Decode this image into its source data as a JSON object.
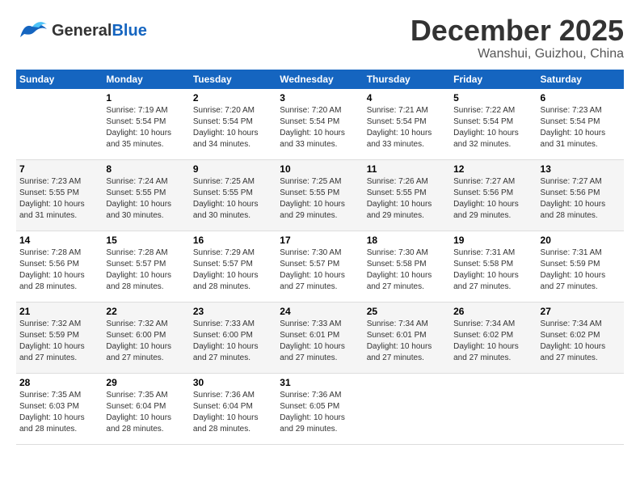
{
  "header": {
    "logo_line1": "General",
    "logo_line2": "Blue",
    "month": "December 2025",
    "location": "Wanshui, Guizhou, China"
  },
  "weekdays": [
    "Sunday",
    "Monday",
    "Tuesday",
    "Wednesday",
    "Thursday",
    "Friday",
    "Saturday"
  ],
  "rows": [
    [
      {
        "day": "",
        "info": ""
      },
      {
        "day": "1",
        "info": "Sunrise: 7:19 AM\nSunset: 5:54 PM\nDaylight: 10 hours\nand 35 minutes."
      },
      {
        "day": "2",
        "info": "Sunrise: 7:20 AM\nSunset: 5:54 PM\nDaylight: 10 hours\nand 34 minutes."
      },
      {
        "day": "3",
        "info": "Sunrise: 7:20 AM\nSunset: 5:54 PM\nDaylight: 10 hours\nand 33 minutes."
      },
      {
        "day": "4",
        "info": "Sunrise: 7:21 AM\nSunset: 5:54 PM\nDaylight: 10 hours\nand 33 minutes."
      },
      {
        "day": "5",
        "info": "Sunrise: 7:22 AM\nSunset: 5:54 PM\nDaylight: 10 hours\nand 32 minutes."
      },
      {
        "day": "6",
        "info": "Sunrise: 7:23 AM\nSunset: 5:54 PM\nDaylight: 10 hours\nand 31 minutes."
      }
    ],
    [
      {
        "day": "7",
        "info": "Sunrise: 7:23 AM\nSunset: 5:55 PM\nDaylight: 10 hours\nand 31 minutes."
      },
      {
        "day": "8",
        "info": "Sunrise: 7:24 AM\nSunset: 5:55 PM\nDaylight: 10 hours\nand 30 minutes."
      },
      {
        "day": "9",
        "info": "Sunrise: 7:25 AM\nSunset: 5:55 PM\nDaylight: 10 hours\nand 30 minutes."
      },
      {
        "day": "10",
        "info": "Sunrise: 7:25 AM\nSunset: 5:55 PM\nDaylight: 10 hours\nand 29 minutes."
      },
      {
        "day": "11",
        "info": "Sunrise: 7:26 AM\nSunset: 5:55 PM\nDaylight: 10 hours\nand 29 minutes."
      },
      {
        "day": "12",
        "info": "Sunrise: 7:27 AM\nSunset: 5:56 PM\nDaylight: 10 hours\nand 29 minutes."
      },
      {
        "day": "13",
        "info": "Sunrise: 7:27 AM\nSunset: 5:56 PM\nDaylight: 10 hours\nand 28 minutes."
      }
    ],
    [
      {
        "day": "14",
        "info": "Sunrise: 7:28 AM\nSunset: 5:56 PM\nDaylight: 10 hours\nand 28 minutes."
      },
      {
        "day": "15",
        "info": "Sunrise: 7:28 AM\nSunset: 5:57 PM\nDaylight: 10 hours\nand 28 minutes."
      },
      {
        "day": "16",
        "info": "Sunrise: 7:29 AM\nSunset: 5:57 PM\nDaylight: 10 hours\nand 28 minutes."
      },
      {
        "day": "17",
        "info": "Sunrise: 7:30 AM\nSunset: 5:57 PM\nDaylight: 10 hours\nand 27 minutes."
      },
      {
        "day": "18",
        "info": "Sunrise: 7:30 AM\nSunset: 5:58 PM\nDaylight: 10 hours\nand 27 minutes."
      },
      {
        "day": "19",
        "info": "Sunrise: 7:31 AM\nSunset: 5:58 PM\nDaylight: 10 hours\nand 27 minutes."
      },
      {
        "day": "20",
        "info": "Sunrise: 7:31 AM\nSunset: 5:59 PM\nDaylight: 10 hours\nand 27 minutes."
      }
    ],
    [
      {
        "day": "21",
        "info": "Sunrise: 7:32 AM\nSunset: 5:59 PM\nDaylight: 10 hours\nand 27 minutes."
      },
      {
        "day": "22",
        "info": "Sunrise: 7:32 AM\nSunset: 6:00 PM\nDaylight: 10 hours\nand 27 minutes."
      },
      {
        "day": "23",
        "info": "Sunrise: 7:33 AM\nSunset: 6:00 PM\nDaylight: 10 hours\nand 27 minutes."
      },
      {
        "day": "24",
        "info": "Sunrise: 7:33 AM\nSunset: 6:01 PM\nDaylight: 10 hours\nand 27 minutes."
      },
      {
        "day": "25",
        "info": "Sunrise: 7:34 AM\nSunset: 6:01 PM\nDaylight: 10 hours\nand 27 minutes."
      },
      {
        "day": "26",
        "info": "Sunrise: 7:34 AM\nSunset: 6:02 PM\nDaylight: 10 hours\nand 27 minutes."
      },
      {
        "day": "27",
        "info": "Sunrise: 7:34 AM\nSunset: 6:02 PM\nDaylight: 10 hours\nand 27 minutes."
      }
    ],
    [
      {
        "day": "28",
        "info": "Sunrise: 7:35 AM\nSunset: 6:03 PM\nDaylight: 10 hours\nand 28 minutes."
      },
      {
        "day": "29",
        "info": "Sunrise: 7:35 AM\nSunset: 6:04 PM\nDaylight: 10 hours\nand 28 minutes."
      },
      {
        "day": "30",
        "info": "Sunrise: 7:36 AM\nSunset: 6:04 PM\nDaylight: 10 hours\nand 28 minutes."
      },
      {
        "day": "31",
        "info": "Sunrise: 7:36 AM\nSunset: 6:05 PM\nDaylight: 10 hours\nand 29 minutes."
      },
      {
        "day": "",
        "info": ""
      },
      {
        "day": "",
        "info": ""
      },
      {
        "day": "",
        "info": ""
      }
    ]
  ]
}
